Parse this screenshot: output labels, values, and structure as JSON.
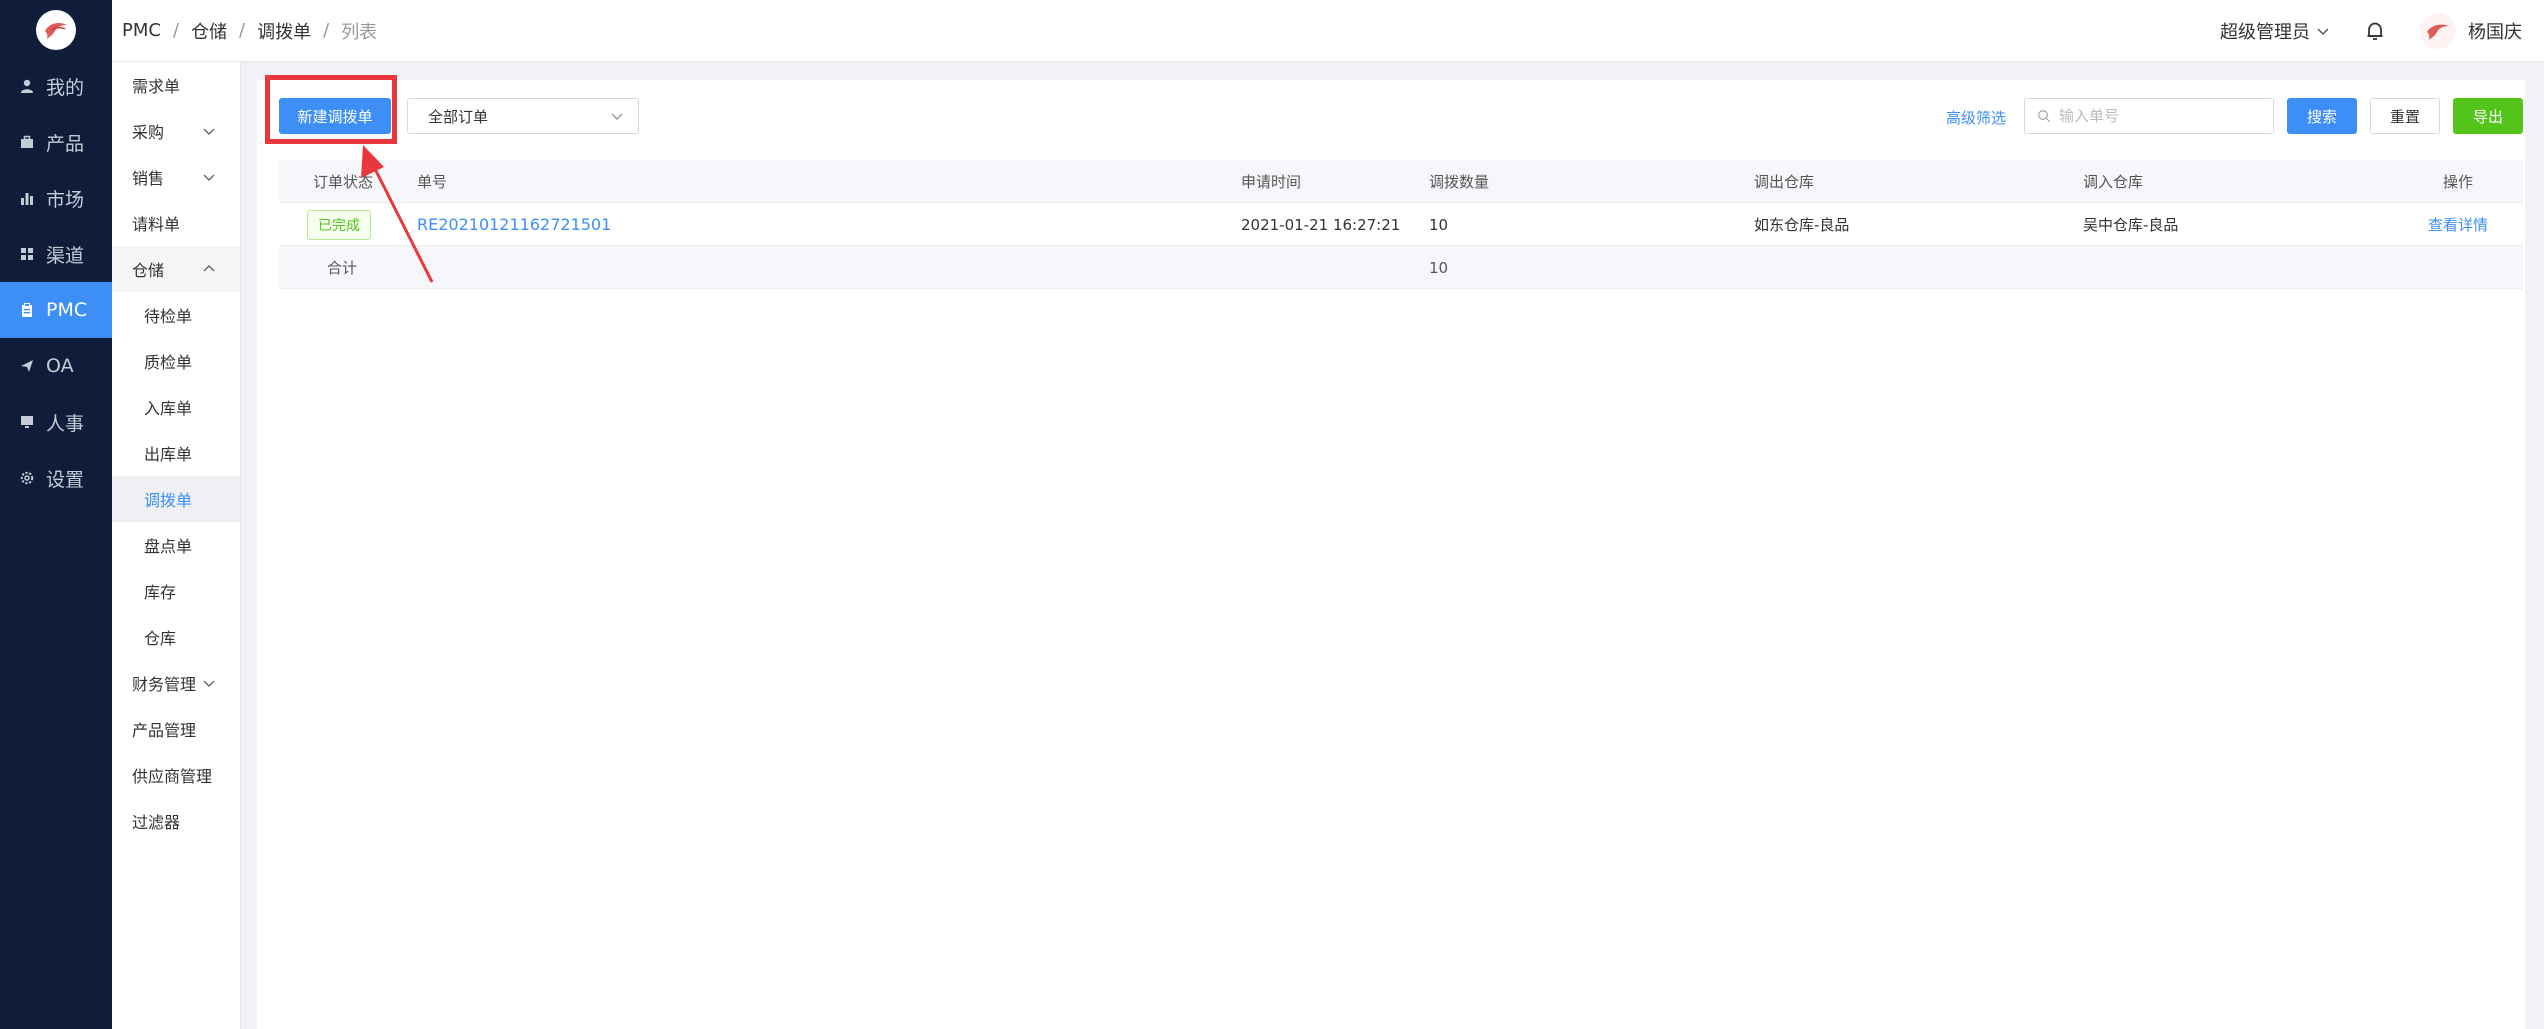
{
  "nav": {
    "items": [
      {
        "label": "我的",
        "icon": "user-icon"
      },
      {
        "label": "产品",
        "icon": "briefcase-icon"
      },
      {
        "label": "市场",
        "icon": "bar-chart-icon"
      },
      {
        "label": "渠道",
        "icon": "grid-icon"
      },
      {
        "label": "PMC",
        "icon": "clipboard-icon"
      },
      {
        "label": "OA",
        "icon": "send-icon"
      },
      {
        "label": "人事",
        "icon": "monitor-icon"
      },
      {
        "label": "设置",
        "icon": "gear-icon"
      }
    ]
  },
  "subnav": {
    "items": [
      {
        "label": "需求单"
      },
      {
        "label": "采购"
      },
      {
        "label": "销售"
      },
      {
        "label": "请料单"
      },
      {
        "label": "仓储"
      },
      {
        "label": "待检单"
      },
      {
        "label": "质检单"
      },
      {
        "label": "入库单"
      },
      {
        "label": "出库单"
      },
      {
        "label": "调拨单"
      },
      {
        "label": "盘点单"
      },
      {
        "label": "库存"
      },
      {
        "label": "仓库"
      },
      {
        "label": "财务管理"
      },
      {
        "label": "产品管理"
      },
      {
        "label": "供应商管理"
      },
      {
        "label": "过滤器"
      }
    ]
  },
  "breadcrumb": [
    "PMC",
    "仓储",
    "调拨单",
    "列表"
  ],
  "header": {
    "role": "超级管理员",
    "user_name": "杨国庆"
  },
  "toolbar": {
    "new_label": "新建调拨单",
    "filter_value": "全部订单",
    "advanced_label": "高级筛选",
    "search_placeholder": "输入单号",
    "search_label": "搜索",
    "reset_label": "重置",
    "export_label": "导出"
  },
  "table": {
    "columns": [
      "订单状态",
      "单号",
      "申请时间",
      "调拨数量",
      "调出仓库",
      "调入仓库",
      "操作"
    ],
    "rows": [
      {
        "status": "已完成",
        "order_no": "RE20210121162721501",
        "time": "2021-01-21 16:27:21",
        "qty": "10",
        "from": "如东仓库-良品",
        "to": "吴中仓库-良品",
        "action": "查看详情"
      }
    ],
    "total": {
      "label": "合计",
      "qty": "10"
    }
  },
  "colors": {
    "accent": "#3d8ff5",
    "rail": "#0f1d3a",
    "success": "#52c41a",
    "highlight": "#e8383d"
  }
}
